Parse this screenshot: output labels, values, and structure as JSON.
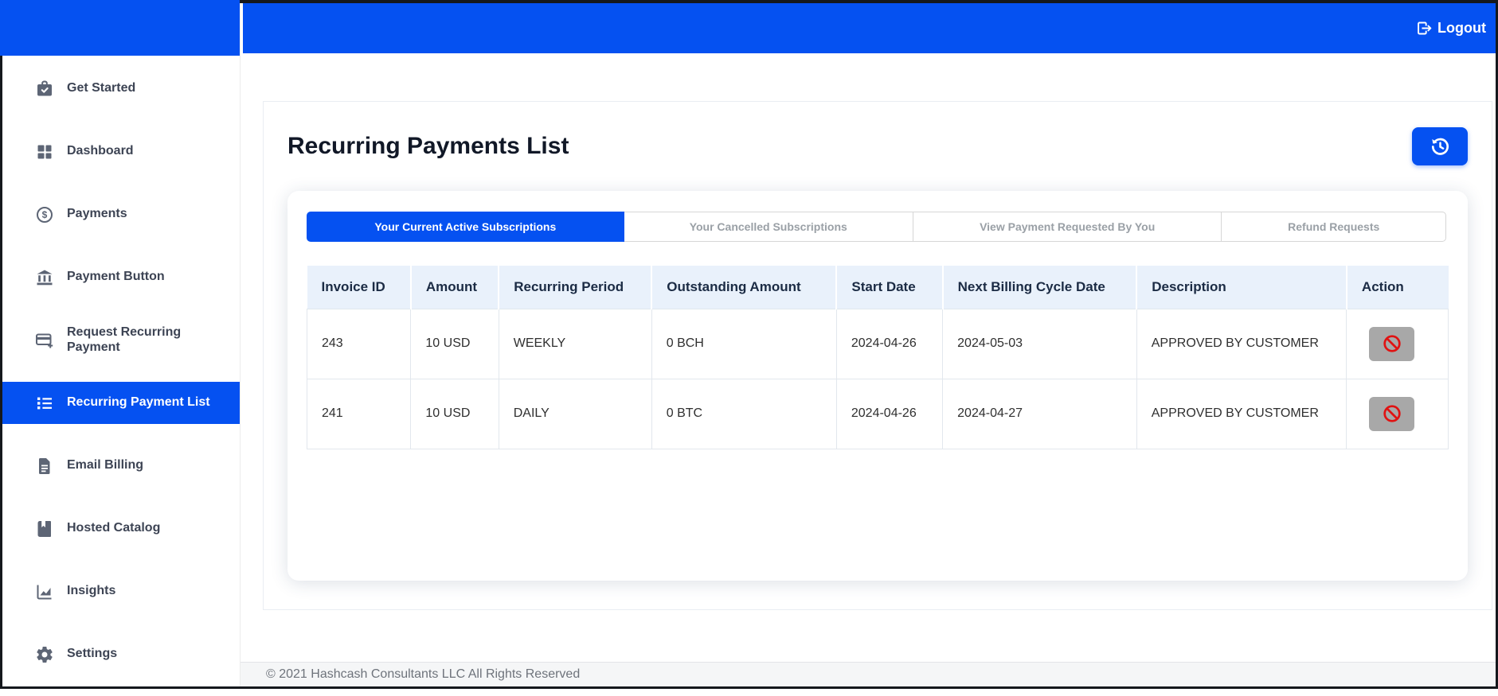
{
  "topbar": {
    "logout_label": "Logout",
    "logout_icon": "sign-out-icon"
  },
  "sidebar": {
    "items": [
      {
        "label": "Get Started",
        "icon": "briefcase-check-icon",
        "active": false
      },
      {
        "label": "Dashboard",
        "icon": "grid-icon",
        "active": false
      },
      {
        "label": "Payments",
        "icon": "dollar-circle-icon",
        "active": false
      },
      {
        "label": "Payment Button",
        "icon": "bank-icon",
        "active": false
      },
      {
        "label": "Request Recurring Payment",
        "icon": "credit-card-plus-icon",
        "active": false
      },
      {
        "label": "Recurring Payment List",
        "icon": "list-icon",
        "active": true
      },
      {
        "label": "Email Billing",
        "icon": "document-icon",
        "active": false
      },
      {
        "label": "Hosted Catalog",
        "icon": "book-icon",
        "active": false
      },
      {
        "label": "Insights",
        "icon": "chart-line-icon",
        "active": false
      },
      {
        "label": "Settings",
        "icon": "gear-icon",
        "active": false
      }
    ]
  },
  "main": {
    "title": "Recurring Payments List",
    "refresh_icon": "history-refresh-icon",
    "tabs": [
      {
        "label": "Your Current Active Subscriptions",
        "active": true
      },
      {
        "label": "Your Cancelled Subscriptions",
        "active": false
      },
      {
        "label": "View Payment Requested By You",
        "active": false
      },
      {
        "label": "Refund Requests",
        "active": false
      }
    ],
    "table": {
      "columns": [
        "Invoice ID",
        "Amount",
        "Recurring Period",
        "Outstanding Amount",
        "Start Date",
        "Next Billing Cycle Date",
        "Description",
        "Action"
      ],
      "rows": [
        {
          "cells": [
            "243",
            "10 USD",
            "WEEKLY",
            "0 BCH",
            "2024-04-26",
            "2024-05-03",
            "APPROVED BY CUSTOMER"
          ],
          "action_icon": "ban-icon"
        },
        {
          "cells": [
            "241",
            "10 USD",
            "DAILY",
            "0 BTC",
            "2024-04-26",
            "2024-04-27",
            "APPROVED BY CUSTOMER"
          ],
          "action_icon": "ban-icon"
        }
      ]
    }
  },
  "footer": {
    "copyright": "© 2021 Hashcash Consultants LLC All Rights Reserved"
  },
  "colors": {
    "accent_blue": "#0551f1",
    "table_header_bg": "#e9f1fb",
    "danger_red": "#e01212",
    "action_button_gray": "#a8a8a8"
  }
}
